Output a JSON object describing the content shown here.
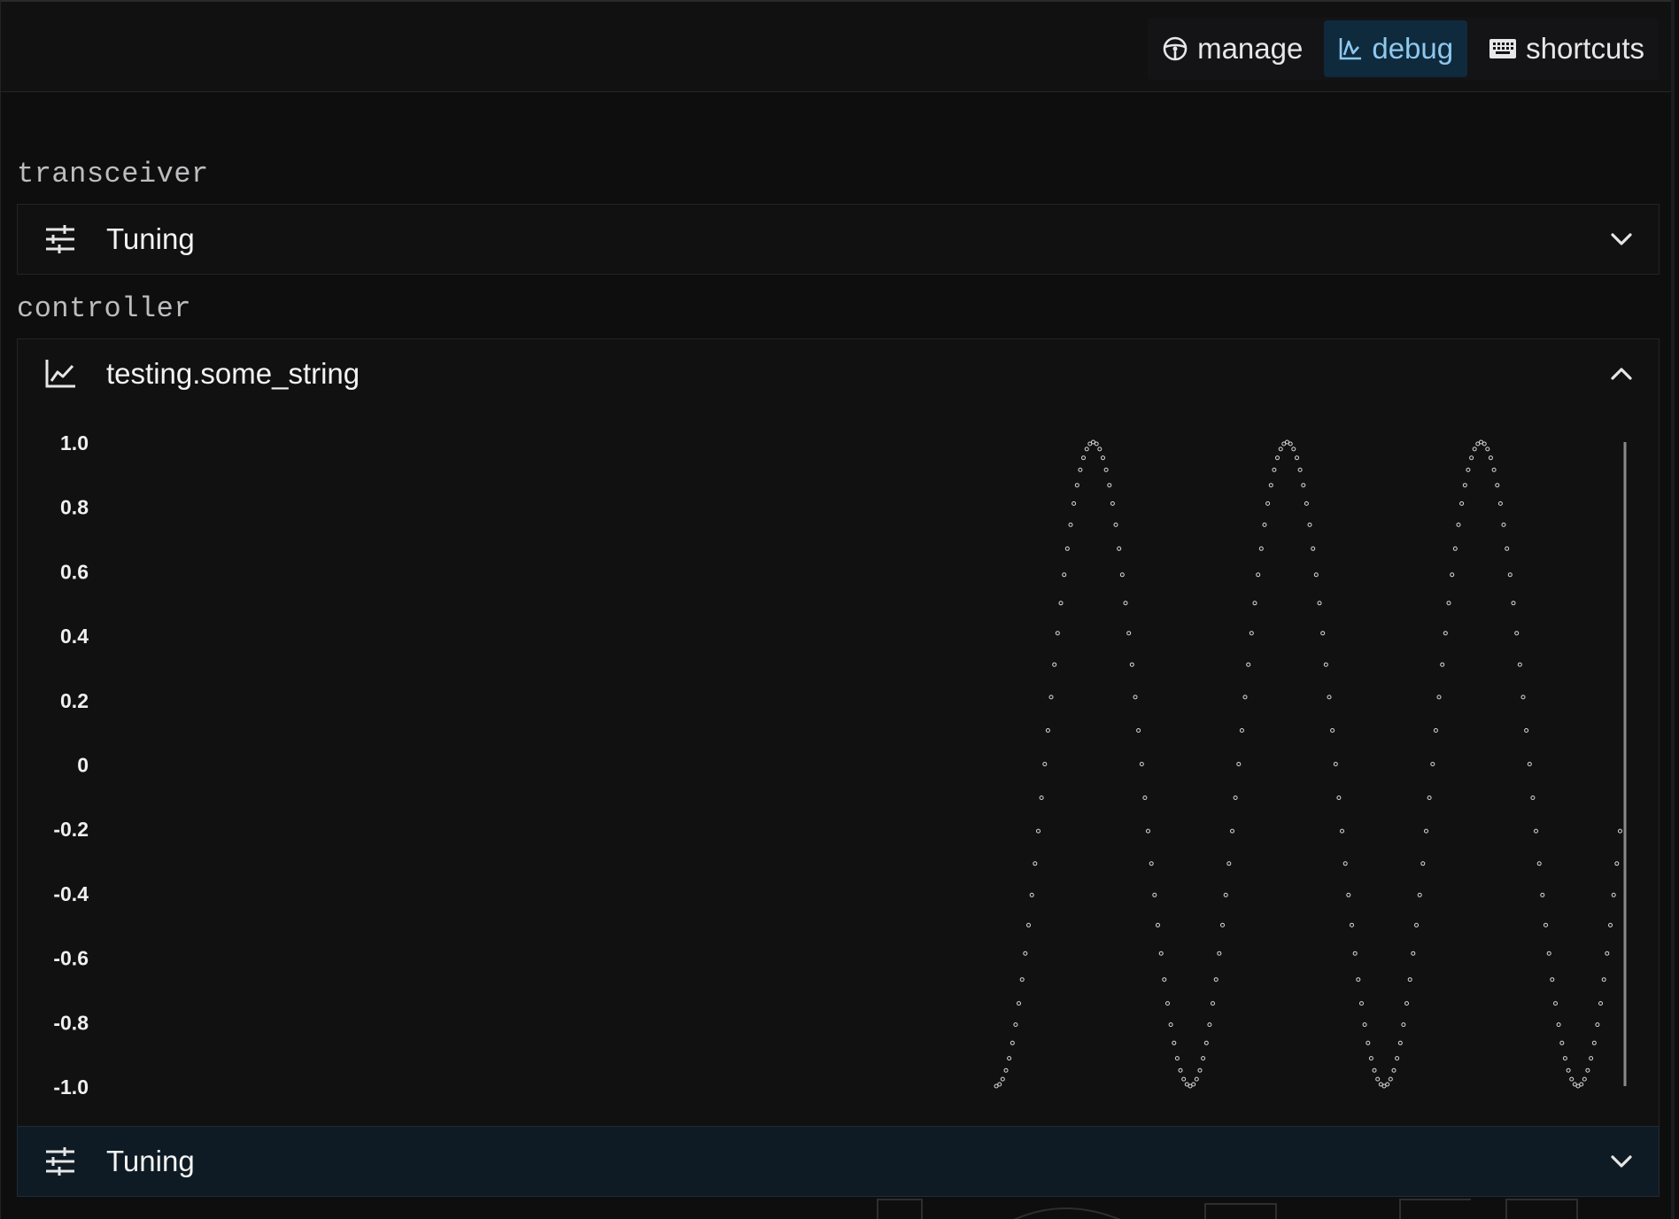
{
  "nav": {
    "items": [
      {
        "label": "manage",
        "icon": "steering-wheel-icon",
        "active": false
      },
      {
        "label": "debug",
        "icon": "chart-icon",
        "active": true
      },
      {
        "label": "shortcuts",
        "icon": "keyboard-icon",
        "active": false
      }
    ]
  },
  "sections": {
    "transceiver": {
      "label": "transceiver",
      "panel_title": "Tuning",
      "panel_icon": "sliders-icon",
      "expanded": false
    },
    "controller": {
      "label": "controller",
      "panel_title": "testing.some_string",
      "panel_icon": "line-chart-icon",
      "expanded": true,
      "footer_title": "Tuning",
      "footer_icon": "sliders-icon"
    }
  },
  "colors": {
    "active_nav_bg": "#0f2a3c",
    "active_nav_text": "#8ec8ef",
    "point_color": "#d9d9d9",
    "footer_bg": "#0f1b24"
  },
  "chart_data": {
    "type": "scatter",
    "title": "",
    "xlabel": "",
    "ylabel": "",
    "ylim": [
      -1.0,
      1.0
    ],
    "y_ticks": [
      "1.0",
      "0.8",
      "0.6",
      "0.4",
      "0.2",
      "0",
      "-0.2",
      "-0.4",
      "-0.6",
      "-0.8",
      "-1.0"
    ],
    "grid": false,
    "series": [
      {
        "description_shape": "sine",
        "points_per_cycle": 60,
        "cycles": 3.45,
        "start_phase_deg": -90,
        "amplitude": 1.0
      }
    ]
  }
}
